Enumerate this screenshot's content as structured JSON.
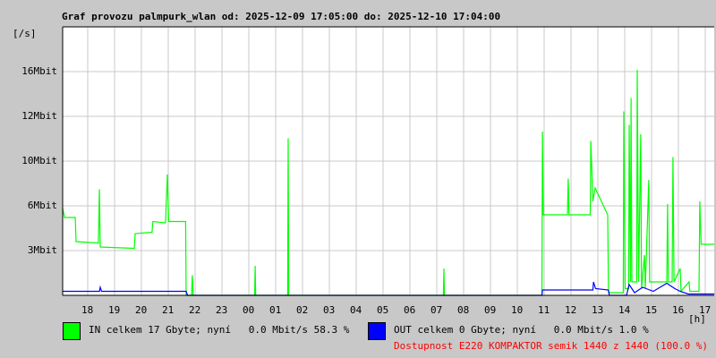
{
  "title": "Graf provozu palmpurk_wlan od: 2025-12-09 17:05:00 do: 2025-12-10 17:04:00",
  "colors": {
    "in": "#00ff00",
    "out": "#0000ff",
    "availability": "#ff0000",
    "grid": "#c8c8c8"
  },
  "chart_data": {
    "type": "line",
    "title": "Graf provozu palmpurk_wlan od: 2025-12-09 17:05:00 do: 2025-12-10 17:04:00",
    "ylabel": "[/s]",
    "xlabel": "[h]",
    "ylim": [
      0,
      20
    ],
    "xlim_hours_from_start": [
      0,
      24.3
    ],
    "y_ticks": [
      {
        "value": 3.33,
        "label": "3Mbit"
      },
      {
        "value": 6.67,
        "label": "6Mbit"
      },
      {
        "value": 10,
        "label": "10Mbit"
      },
      {
        "value": 13.33,
        "label": "12Mbit"
      },
      {
        "value": 16.67,
        "label": "16Mbit"
      }
    ],
    "x_ticks": [
      "18",
      "19",
      "20",
      "21",
      "22",
      "23",
      "00",
      "01",
      "02",
      "03",
      "04",
      "05",
      "06",
      "07",
      "08",
      "09",
      "10",
      "11",
      "12",
      "13",
      "14",
      "15",
      "16",
      "17"
    ],
    "grid": true,
    "series": [
      {
        "name": "IN",
        "color": "#00ff00",
        "points": [
          [
            0,
            6.5
          ],
          [
            0.07,
            5.8
          ],
          [
            0.47,
            5.8
          ],
          [
            0.5,
            4
          ],
          [
            1.33,
            3.9
          ],
          [
            1.37,
            7.9
          ],
          [
            1.4,
            3.6
          ],
          [
            2.67,
            3.5
          ],
          [
            2.7,
            4.6
          ],
          [
            3.33,
            4.7
          ],
          [
            3.36,
            5.5
          ],
          [
            3.83,
            5.4
          ],
          [
            3.9,
            9
          ],
          [
            3.95,
            5.5
          ],
          [
            4.58,
            5.5
          ],
          [
            4.6,
            0
          ],
          [
            4.8,
            0
          ],
          [
            4.83,
            1.5
          ],
          [
            4.86,
            0
          ],
          [
            7.15,
            0
          ],
          [
            7.17,
            2.2
          ],
          [
            7.19,
            0
          ],
          [
            8.38,
            0
          ],
          [
            8.4,
            11.7
          ],
          [
            8.42,
            0
          ],
          [
            14.18,
            0
          ],
          [
            14.2,
            2
          ],
          [
            14.22,
            0
          ],
          [
            17.85,
            0
          ],
          [
            17.87,
            12.2
          ],
          [
            17.9,
            6
          ],
          [
            18.8,
            6
          ],
          [
            18.83,
            8.7
          ],
          [
            18.86,
            6
          ],
          [
            19.65,
            6
          ],
          [
            19.67,
            11.5
          ],
          [
            19.75,
            7
          ],
          [
            19.83,
            8
          ],
          [
            20.3,
            6
          ],
          [
            20.33,
            0.2
          ],
          [
            20.88,
            0.2
          ],
          [
            20.9,
            13.7
          ],
          [
            20.95,
            0.5
          ],
          [
            21.08,
            0.5
          ],
          [
            21.1,
            12.7
          ],
          [
            21.15,
            1
          ],
          [
            21.17,
            14.7
          ],
          [
            21.2,
            1
          ],
          [
            21.38,
            1
          ],
          [
            21.4,
            16.8
          ],
          [
            21.45,
            1
          ],
          [
            21.53,
            12
          ],
          [
            21.56,
            0.5
          ],
          [
            21.67,
            3
          ],
          [
            21.7,
            0.5
          ],
          [
            21.83,
            8.6
          ],
          [
            21.86,
            1
          ],
          [
            22.5,
            1
          ],
          [
            22.53,
            6.8
          ],
          [
            22.56,
            1
          ],
          [
            22.7,
            1
          ],
          [
            22.73,
            10.3
          ],
          [
            22.77,
            1
          ],
          [
            23,
            2
          ],
          [
            23.03,
            0.3
          ],
          [
            23.33,
            1
          ],
          [
            23.36,
            0.3
          ],
          [
            23.7,
            0.3
          ],
          [
            23.73,
            7
          ],
          [
            23.78,
            3.8
          ],
          [
            24.27,
            3.8
          ]
        ]
      },
      {
        "name": "OUT",
        "color": "#0000ff",
        "points": [
          [
            0,
            0.3
          ],
          [
            1.37,
            0.3
          ],
          [
            1.4,
            0.6
          ],
          [
            1.45,
            0.3
          ],
          [
            4.6,
            0.3
          ],
          [
            4.65,
            0
          ],
          [
            17.85,
            0
          ],
          [
            17.87,
            0.4
          ],
          [
            19.75,
            0.4
          ],
          [
            19.77,
            1
          ],
          [
            19.85,
            0.5
          ],
          [
            20.33,
            0.4
          ],
          [
            20.36,
            0
          ],
          [
            21.0,
            0
          ],
          [
            21.1,
            0.8
          ],
          [
            21.3,
            0.2
          ],
          [
            21.6,
            0.6
          ],
          [
            22.0,
            0.3
          ],
          [
            22.5,
            0.9
          ],
          [
            22.8,
            0.5
          ],
          [
            23.0,
            0.3
          ],
          [
            23.3,
            0.1
          ],
          [
            24.27,
            0.1
          ]
        ]
      }
    ]
  },
  "legend": {
    "in": "IN celkem 17 Gbyte; nyní   0.0 Mbit/s 58.3 %",
    "out": "OUT celkem 0 Gbyte; nyní   0.0 Mbit/s 1.0 %",
    "availability": "Dostupnost E220 KOMPAKTOR semik 1440 z 1440 (100.0 %)"
  }
}
